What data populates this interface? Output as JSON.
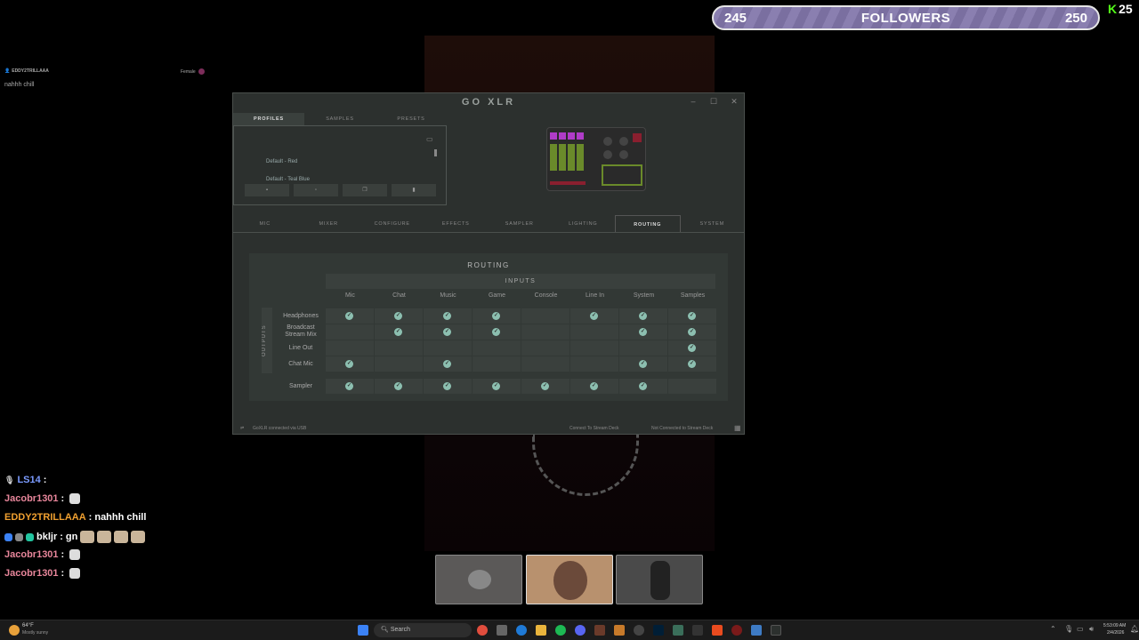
{
  "followers": {
    "current": "245",
    "label": "FOLLOWERS",
    "goal": "250",
    "kick_count": "25",
    "progress_fraction": 0.98
  },
  "top_chat": {
    "username": "EDDY2TRILLAAA",
    "gender": "Female",
    "message": "nahhh chill"
  },
  "goxlr": {
    "title": "GO XLR",
    "profile_tabs": [
      "PROFILES",
      "SAMPLES",
      "PRESETS"
    ],
    "profiles": [
      "Default - Red",
      "Default - Teal Blue"
    ],
    "profile_buttons": [
      "save-icon",
      "new-icon",
      "copy-icon",
      "delete-icon"
    ],
    "main_tabs": [
      "MIC",
      "MIXER",
      "CONFIGURE",
      "EFFECTS",
      "SAMPLER",
      "LIGHTING",
      "ROUTING",
      "SYSTEM"
    ],
    "active_tab": "ROUTING",
    "routing": {
      "title": "ROUTING",
      "inputs_label": "INPUTS",
      "outputs_label": "OUTPUTS",
      "columns": [
        "Mic",
        "Chat",
        "Music",
        "Game",
        "Console",
        "Line In",
        "System",
        "Samples"
      ],
      "rows": [
        {
          "label": "Headphones",
          "checks": [
            true,
            true,
            true,
            true,
            false,
            true,
            true,
            true
          ]
        },
        {
          "label": "Broadcast Stream Mix",
          "checks": [
            false,
            true,
            true,
            true,
            false,
            false,
            true,
            true
          ]
        },
        {
          "label": "Line Out",
          "checks": [
            false,
            false,
            false,
            false,
            false,
            false,
            false,
            true
          ]
        },
        {
          "label": "Chat Mic",
          "checks": [
            true,
            false,
            true,
            false,
            false,
            false,
            true,
            true
          ]
        }
      ],
      "sampler_row": {
        "label": "Sampler",
        "checks": [
          true,
          true,
          true,
          true,
          true,
          true,
          true,
          false
        ]
      }
    },
    "status": {
      "usb": "GoXLR connected via USB",
      "stream_deck_btn": "Connect To Stream Deck",
      "stream_deck_status": "Not Connected to Stream Deck"
    }
  },
  "chat": [
    {
      "user": "LS14",
      "color": "#7b9bff",
      "message": "",
      "badge": "mic-badge"
    },
    {
      "user": "Jacobr1301",
      "color": "#e8869b",
      "message": "",
      "emote": "ghost-emote"
    },
    {
      "user": "EDDY2TRILLAAA",
      "color": "#f0a030",
      "message": "nahhh chill"
    },
    {
      "user": "bkljr",
      "color": "#ffffff",
      "message": "gn",
      "emotes": 4
    },
    {
      "user": "Jacobr1301",
      "color": "#e8869b",
      "message": "",
      "emote": "ghost-emote"
    },
    {
      "user": "Jacobr1301",
      "color": "#e8869b",
      "message": "",
      "emote": "ghost-emote"
    }
  ],
  "taskbar": {
    "weather_temp": "64°F",
    "weather_desc": "Mostly sunny",
    "search_placeholder": "Search",
    "time": "5:53:09 AM",
    "date": "2/4/2026"
  }
}
